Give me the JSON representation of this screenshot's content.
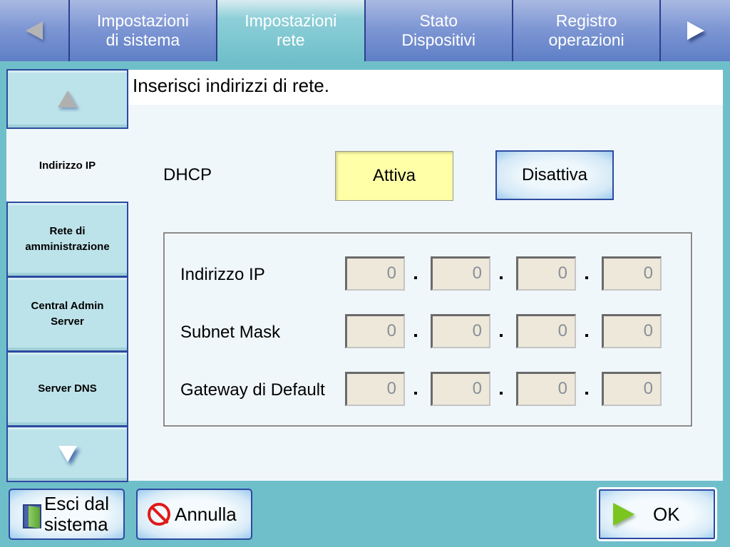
{
  "tabs": {
    "prev_icon": "triangle-left-icon",
    "next_icon": "triangle-right-icon",
    "items": [
      {
        "label": "Impostazioni\ndi sistema",
        "active": false
      },
      {
        "label": "Impostazioni\nrete",
        "active": true
      },
      {
        "label": "Stato\nDispositivi",
        "active": false
      },
      {
        "label": "Registro\noperazioni",
        "active": false
      }
    ]
  },
  "sidebar": {
    "up_icon": "triangle-up-icon",
    "down_icon": "triangle-down-icon",
    "items": [
      {
        "label": "Indirizzo IP",
        "active": true
      },
      {
        "label": "Rete di\namministrazione",
        "active": false
      },
      {
        "label": "Central Admin\nServer",
        "active": false
      },
      {
        "label": "Server DNS",
        "active": false
      }
    ]
  },
  "main": {
    "instruction": "Inserisci indirizzi di rete.",
    "dhcp": {
      "label": "DHCP",
      "on_label": "Attiva",
      "off_label": "Disattiva",
      "selected": "Attiva"
    },
    "fields": [
      {
        "label": "Indirizzo IP",
        "octets": [
          "0",
          "0",
          "0",
          "0"
        ]
      },
      {
        "label": "Subnet Mask",
        "octets": [
          "0",
          "0",
          "0",
          "0"
        ]
      },
      {
        "label": "Gateway di Default",
        "octets": [
          "0",
          "0",
          "0",
          "0"
        ]
      }
    ],
    "separator": "."
  },
  "footer": {
    "exit_label_line1": "Esci dal",
    "exit_label_line2": "sistema",
    "exit_icon": "door-exit-icon",
    "cancel_label": "Annulla",
    "cancel_icon": "no-entry-icon",
    "ok_label": "OK",
    "ok_icon": "play-arrow-icon"
  },
  "colors": {
    "background": "#6fbfca",
    "tab_inactive": "#7f97d4",
    "tab_active": "#6fbfca",
    "border_blue": "#2d4aa0",
    "dhcp_selected": "#ffffa8",
    "field_bg": "#ede8da"
  }
}
